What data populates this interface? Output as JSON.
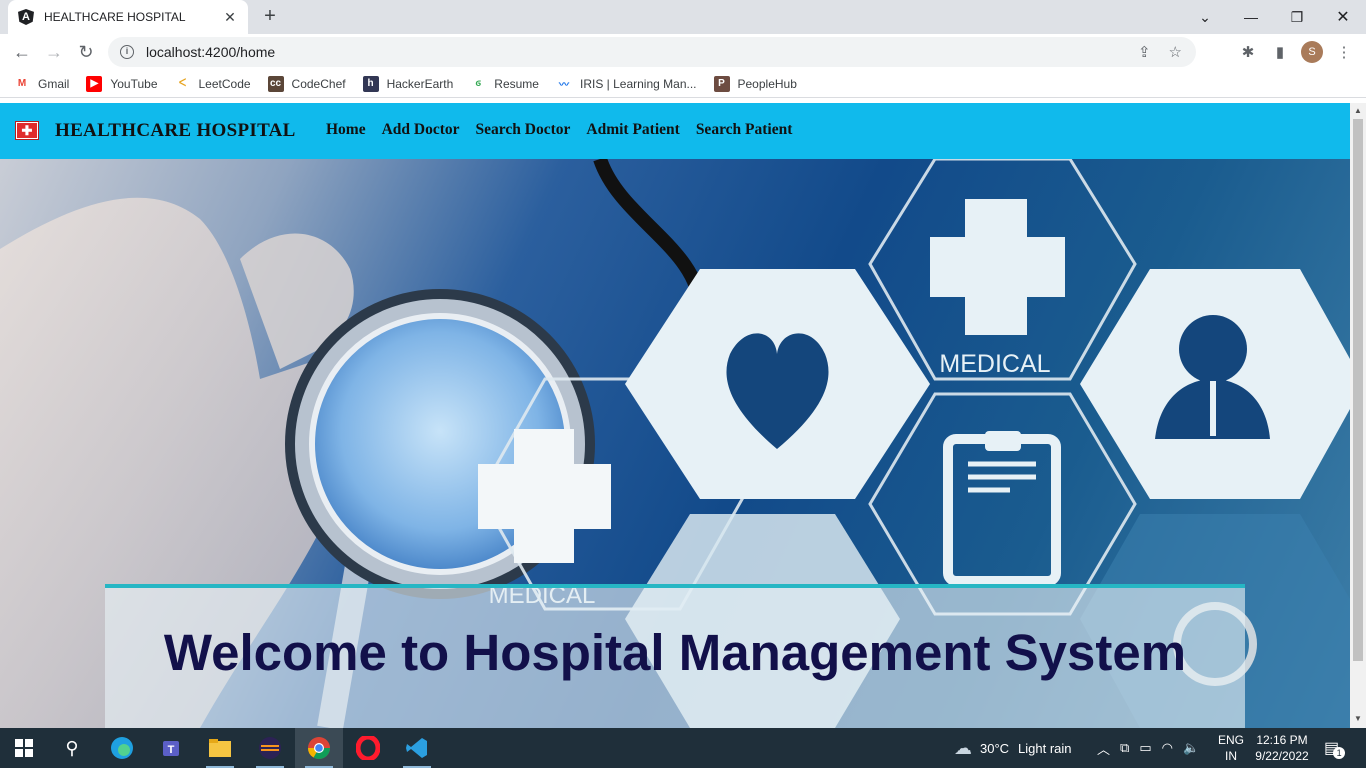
{
  "browser": {
    "tab_title": "HEALTHCARE HOSPITAL",
    "tab_favicon": "A",
    "tab_close": "✕",
    "new_tab": "+",
    "url": "localhost:4200/home",
    "profile_initial": "S",
    "bookmarks": [
      {
        "label": "Gmail",
        "icon": "gmail-icon",
        "glyph": "M",
        "color": "#ffffff",
        "fg": "#ea4335"
      },
      {
        "label": "YouTube",
        "icon": "youtube-icon",
        "glyph": "▶",
        "color": "#ff0000",
        "fg": "#ffffff"
      },
      {
        "label": "LeetCode",
        "icon": "leetcode-icon",
        "glyph": "ᐸ",
        "color": "#ffffff",
        "fg": "#e7a41f"
      },
      {
        "label": "CodeChef",
        "icon": "codechef-icon",
        "glyph": "cc",
        "color": "#5b4638",
        "fg": "#ffffff"
      },
      {
        "label": "HackerEarth",
        "icon": "hackerearth-icon",
        "glyph": "h",
        "color": "#323754",
        "fg": "#ffffff"
      },
      {
        "label": "Resume",
        "icon": "resume-icon",
        "glyph": "ϭ",
        "color": "#ffffff",
        "fg": "#34a853"
      },
      {
        "label": "IRIS | Learning Man...",
        "icon": "iris-icon",
        "glyph": "〰",
        "color": "#ffffff",
        "fg": "#1a73e8"
      },
      {
        "label": "PeopleHub",
        "icon": "peoplehub-icon",
        "glyph": "P",
        "color": "#6d4c41",
        "fg": "#ffffff"
      }
    ]
  },
  "navbar": {
    "brand": "HEALTHCARE HOSPITAL",
    "links": [
      "Home",
      "Add Doctor",
      "Search Doctor",
      "Admit Patient",
      "Search Patient"
    ]
  },
  "hero": {
    "welcome": "Welcome to Hospital Management System",
    "image_labels": [
      "MEDICAL",
      "MEDICAL"
    ]
  },
  "taskbar": {
    "weather_temp": "30°C",
    "weather_desc": "Light rain",
    "lang_top": "ENG",
    "lang_bottom": "IN",
    "time": "12:16 PM",
    "date": "9/22/2022",
    "notification_count": "1"
  }
}
